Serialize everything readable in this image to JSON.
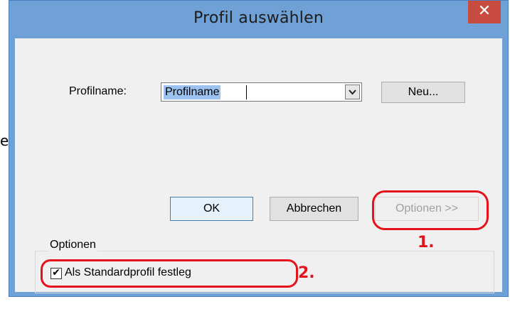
{
  "left_fragment": "e",
  "dialog": {
    "title": "Profil auswählen",
    "close_glyph": "✕",
    "profile_label": "Profilname:",
    "profile_value": "Profilname",
    "dropdown_icon": "chevron-down-icon",
    "new_button": "Neu...",
    "ok_button": "OK",
    "cancel_button": "Abbrechen",
    "options_button": "Optionen >>",
    "options_group_label": "Optionen",
    "default_profile_checkbox": {
      "label": "Als Standardprofil festleg",
      "checked": true
    }
  },
  "annotations": {
    "step1": "1.",
    "step2": "2.",
    "color": "#e5121b"
  },
  "colors": {
    "titlebar": "#6fa0d6",
    "close": "#c74b3f",
    "selection": "#9cc3f0"
  }
}
